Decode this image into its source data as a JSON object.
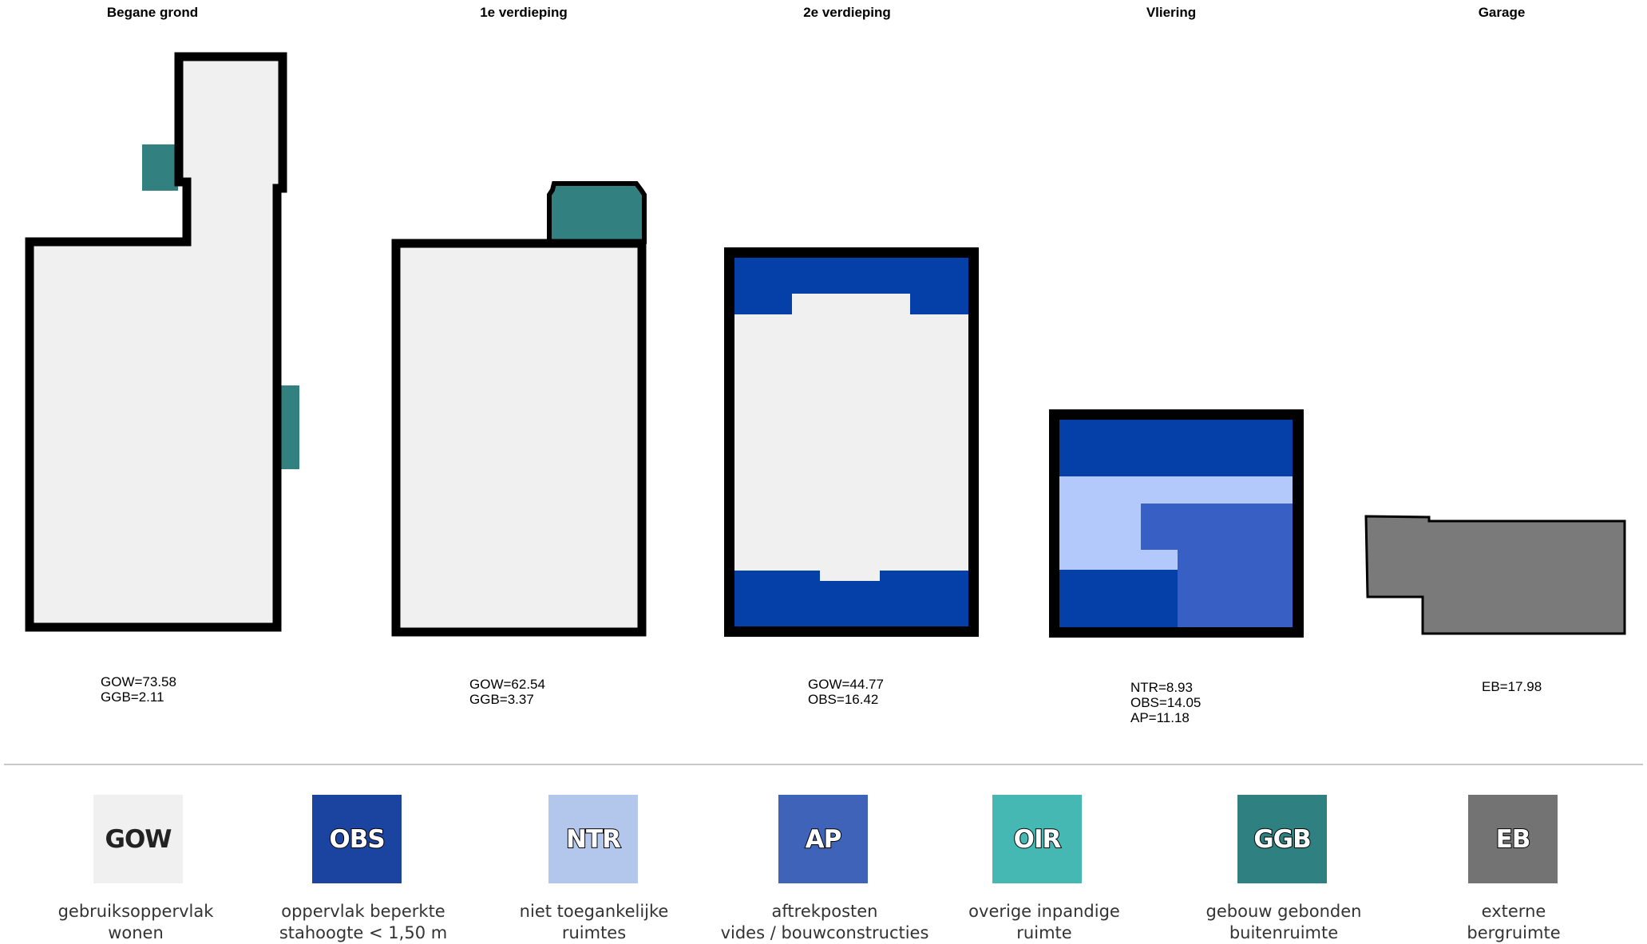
{
  "floors": [
    {
      "title": "Begane grond",
      "stats": [
        "GOW=73.58",
        "GGB=2.11"
      ]
    },
    {
      "title": "1e verdieping",
      "stats": [
        "GOW=62.54",
        "GGB=3.37"
      ]
    },
    {
      "title": "2e verdieping",
      "stats": [
        "GOW=44.77",
        "OBS=16.42"
      ]
    },
    {
      "title": "Vliering",
      "stats": [
        "NTR=8.93",
        "OBS=14.05",
        "AP=11.18"
      ]
    },
    {
      "title": "Garage",
      "stats": [
        "EB=17.98"
      ]
    }
  ],
  "legend": [
    {
      "code": "GOW",
      "color": "#f0f0f0",
      "line1": "gebruiksoppervlak",
      "line2": "wonen"
    },
    {
      "code": "OBS",
      "color": "#1a44a0",
      "line1": "oppervlak beperkte",
      "line2": "stahoogte < 1,50 m"
    },
    {
      "code": "NTR",
      "color": "#b3c6eb",
      "line1": "niet toegankelijke",
      "line2": "ruimtes"
    },
    {
      "code": "AP",
      "color": "#3f63b8",
      "line1": "aftrekposten",
      "line2": "vides / bouwconstructies"
    },
    {
      "code": "OIR",
      "color": "#45b8b4",
      "line1": "overige inpandige",
      "line2": "ruimte"
    },
    {
      "code": "GGB",
      "color": "#2f8080",
      "line1": "gebouw gebonden",
      "line2": "buitenruimte"
    },
    {
      "code": "EB",
      "color": "#737373",
      "line1": "externe",
      "line2": "bergruimte"
    }
  ],
  "colors": {
    "GOW": "#f0f0f0",
    "OBS": "#0540a8",
    "NTR": "#b3c9fb",
    "AP": "#3860c4",
    "GGB": "#338080",
    "EB": "#7a7a7a",
    "wall": "#000000"
  }
}
